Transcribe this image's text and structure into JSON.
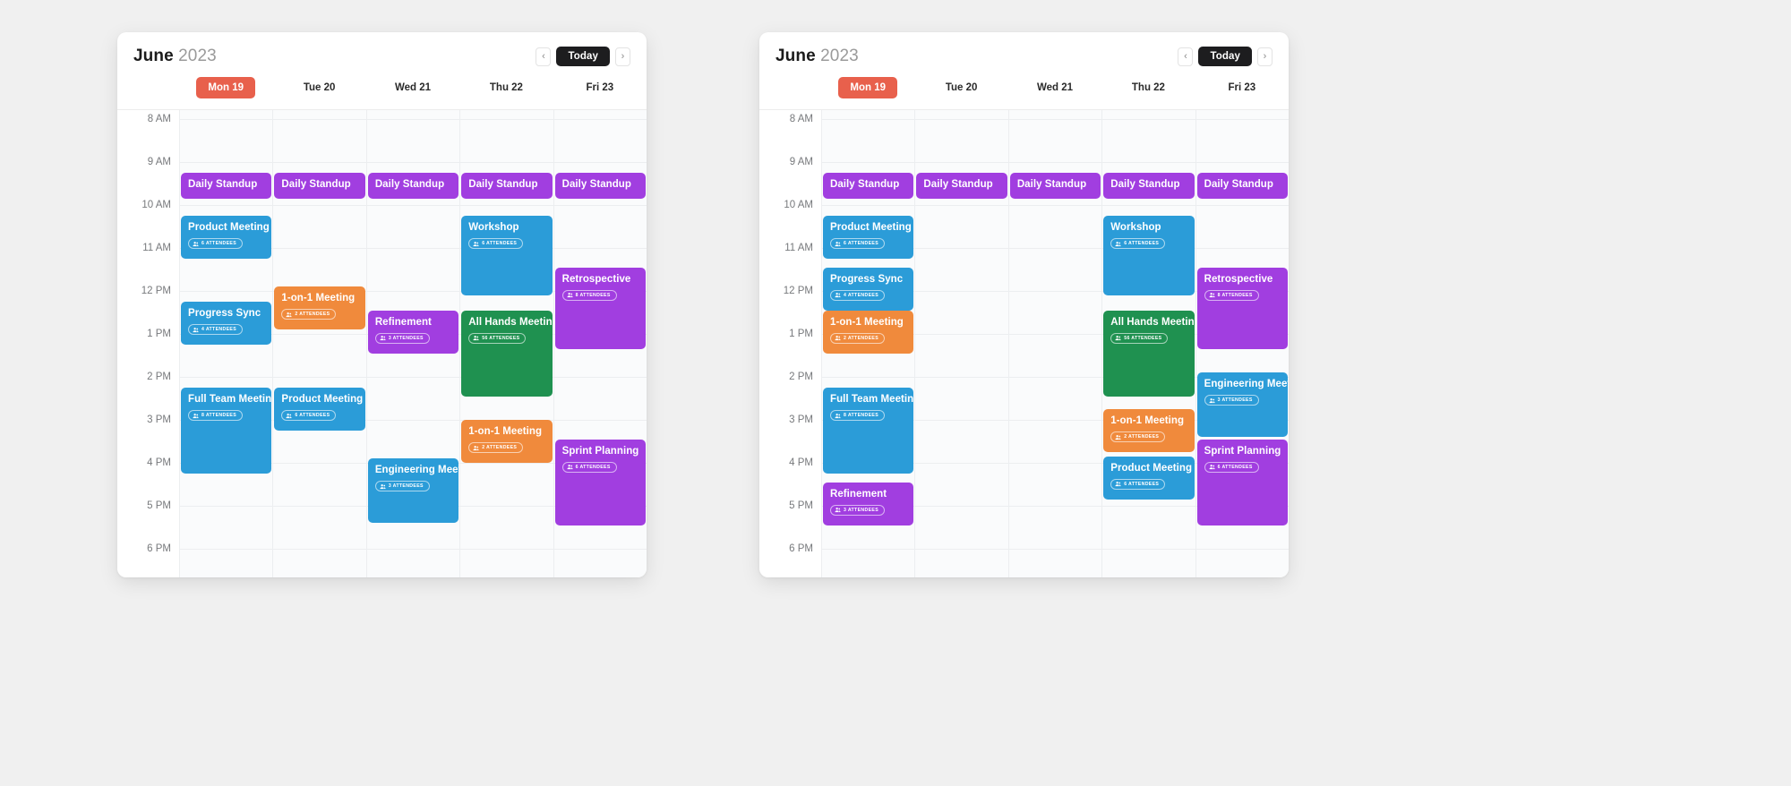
{
  "colors": {
    "purple": "#a13ee0",
    "blue": "#2b9cd8",
    "orange": "#f08a3c",
    "green": "#1f9150",
    "accent_today": "#e8604c",
    "today_button_bg": "#1d1d1f",
    "page_bg": "#f0f0f0",
    "grid_bg": "#fafbfc"
  },
  "header": {
    "month": "June",
    "year": "2023",
    "prev_label": "‹",
    "next_label": "›",
    "today_label": "Today",
    "prev_icon": "chevron-left-icon",
    "next_icon": "chevron-right-icon"
  },
  "days": [
    {
      "label": "Mon 19",
      "today": true
    },
    {
      "label": "Tue 20",
      "today": false
    },
    {
      "label": "Wed 21",
      "today": false
    },
    {
      "label": "Thu 22",
      "today": false
    },
    {
      "label": "Fri 23",
      "today": false
    }
  ],
  "time_labels": [
    "8 AM",
    "9 AM",
    "10 AM",
    "11 AM",
    "12 PM",
    "1 PM",
    "2 PM",
    "3 PM",
    "4 PM",
    "5 PM",
    "6 PM"
  ],
  "attendee_icon": "people-icon",
  "attendee_suffix": "ATTENDEES",
  "calendars": [
    {
      "id": "calendar-left",
      "events": [
        {
          "title": "Daily Standup",
          "color": "purple",
          "day": 0,
          "start": 1.25,
          "end": 1.85,
          "attendees": null
        },
        {
          "title": "Daily Standup",
          "color": "purple",
          "day": 1,
          "start": 1.25,
          "end": 1.85,
          "attendees": null
        },
        {
          "title": "Daily Standup",
          "color": "purple",
          "day": 2,
          "start": 1.25,
          "end": 1.85,
          "attendees": null
        },
        {
          "title": "Daily Standup",
          "color": "purple",
          "day": 3,
          "start": 1.25,
          "end": 1.85,
          "attendees": null
        },
        {
          "title": "Daily Standup",
          "color": "purple",
          "day": 4,
          "start": 1.25,
          "end": 1.85,
          "attendees": null
        },
        {
          "title": "Product Meeting",
          "color": "blue",
          "day": 0,
          "start": 2.25,
          "end": 3.25,
          "attendees": "6"
        },
        {
          "title": "Progress Sync",
          "color": "blue",
          "day": 0,
          "start": 4.25,
          "end": 5.25,
          "attendees": "4"
        },
        {
          "title": "Full Team Meeting",
          "color": "blue",
          "day": 0,
          "start": 6.25,
          "end": 8.25,
          "attendees": "8"
        },
        {
          "title": "1-on-1 Meeting",
          "color": "orange",
          "day": 1,
          "start": 3.9,
          "end": 4.9,
          "attendees": "2"
        },
        {
          "title": "Product Meeting",
          "color": "blue",
          "day": 1,
          "start": 6.25,
          "end": 7.25,
          "attendees": "6"
        },
        {
          "title": "Refinement",
          "color": "purple",
          "day": 2,
          "start": 4.45,
          "end": 5.45,
          "attendees": "3"
        },
        {
          "title": "Engineering Meeting",
          "color": "blue",
          "day": 2,
          "start": 7.9,
          "end": 9.4,
          "attendees": "3"
        },
        {
          "title": "Workshop",
          "color": "blue",
          "day": 3,
          "start": 2.25,
          "end": 4.1,
          "attendees": "6"
        },
        {
          "title": "All Hands Meeting",
          "color": "green",
          "day": 3,
          "start": 4.45,
          "end": 6.45,
          "attendees": "56"
        },
        {
          "title": "1-on-1 Meeting",
          "color": "orange",
          "day": 3,
          "start": 7.0,
          "end": 8.0,
          "attendees": "2"
        },
        {
          "title": "Retrospective",
          "color": "purple",
          "day": 4,
          "start": 3.45,
          "end": 5.35,
          "attendees": "8"
        },
        {
          "title": "Sprint Planning",
          "color": "purple",
          "day": 4,
          "start": 7.45,
          "end": 9.45,
          "attendees": "6"
        }
      ]
    },
    {
      "id": "calendar-right",
      "events": [
        {
          "title": "Daily Standup",
          "color": "purple",
          "day": 0,
          "start": 1.25,
          "end": 1.85,
          "attendees": null
        },
        {
          "title": "Daily Standup",
          "color": "purple",
          "day": 1,
          "start": 1.25,
          "end": 1.85,
          "attendees": null
        },
        {
          "title": "Daily Standup",
          "color": "purple",
          "day": 2,
          "start": 1.25,
          "end": 1.85,
          "attendees": null
        },
        {
          "title": "Daily Standup",
          "color": "purple",
          "day": 3,
          "start": 1.25,
          "end": 1.85,
          "attendees": null
        },
        {
          "title": "Daily Standup",
          "color": "purple",
          "day": 4,
          "start": 1.25,
          "end": 1.85,
          "attendees": null
        },
        {
          "title": "Product Meeting",
          "color": "blue",
          "day": 0,
          "start": 2.25,
          "end": 3.25,
          "attendees": "6"
        },
        {
          "title": "Progress Sync",
          "color": "blue",
          "day": 0,
          "start": 3.45,
          "end": 4.45,
          "attendees": "4"
        },
        {
          "title": "1-on-1 Meeting",
          "color": "orange",
          "day": 0,
          "start": 4.45,
          "end": 5.45,
          "attendees": "2"
        },
        {
          "title": "Full Team Meeting",
          "color": "blue",
          "day": 0,
          "start": 6.25,
          "end": 8.25,
          "attendees": "8"
        },
        {
          "title": "Refinement",
          "color": "purple",
          "day": 0,
          "start": 8.45,
          "end": 9.45,
          "attendees": "3"
        },
        {
          "title": "Workshop",
          "color": "blue",
          "day": 3,
          "start": 2.25,
          "end": 4.1,
          "attendees": "6"
        },
        {
          "title": "All Hands Meeting",
          "color": "green",
          "day": 3,
          "start": 4.45,
          "end": 6.45,
          "attendees": "56"
        },
        {
          "title": "1-on-1 Meeting",
          "color": "orange",
          "day": 3,
          "start": 6.75,
          "end": 7.75,
          "attendees": "2"
        },
        {
          "title": "Product Meeting",
          "color": "blue",
          "day": 3,
          "start": 7.85,
          "end": 8.85,
          "attendees": "6"
        },
        {
          "title": "Retrospective",
          "color": "purple",
          "day": 4,
          "start": 3.45,
          "end": 5.35,
          "attendees": "8"
        },
        {
          "title": "Engineering Meeting",
          "color": "blue",
          "day": 4,
          "start": 5.9,
          "end": 7.4,
          "attendees": "3"
        },
        {
          "title": "Sprint Planning",
          "color": "purple",
          "day": 4,
          "start": 7.45,
          "end": 9.45,
          "attendees": "6"
        }
      ]
    }
  ]
}
